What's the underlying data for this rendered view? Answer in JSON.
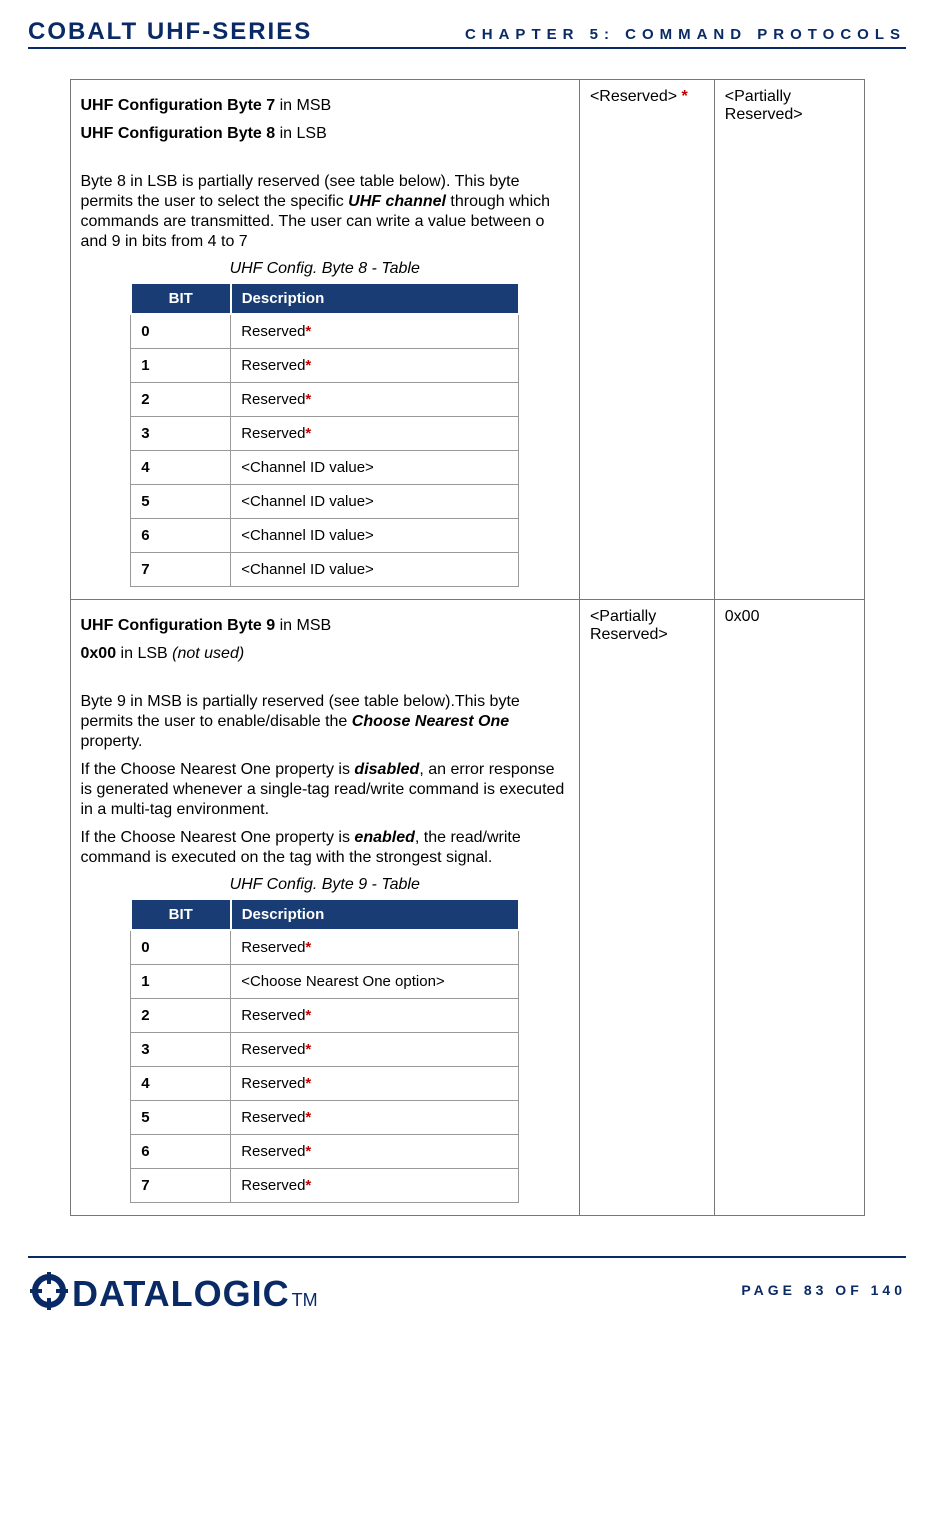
{
  "header": {
    "left": "COBALT UHF-SERIES",
    "right": "CHAPTER 5: COMMAND PROTOCOLS"
  },
  "footer": {
    "logo_text": "DATALOGIC",
    "tm": "TM",
    "page_text": "PAGE 83 OF 140"
  },
  "row1": {
    "line1a": "UHF Configuration Byte 7",
    "line1b": "  in MSB",
    "line2a": "UHF Configuration Byte 8",
    "line2b": " in LSB",
    "para1a": "Byte 8 in LSB is partially reserved (see table below). This byte permits the user to select the specific  ",
    "para1b": "UHF channel",
    "para1c": " through which commands are transmitted. The user can write a value between o and 9 in bits from 4 to 7",
    "caption": "UHF Config. Byte 8 - Table",
    "th_bit": "BIT",
    "th_desc": "Description",
    "bits": [
      {
        "bit": "0",
        "desc": "Reserved",
        "star": "*"
      },
      {
        "bit": "1",
        "desc": "Reserved",
        "star": "*"
      },
      {
        "bit": "2",
        "desc": "Reserved",
        "star": "*"
      },
      {
        "bit": "3",
        "desc": "Reserved",
        "star": "*"
      },
      {
        "bit": "4",
        "desc": "<Channel ID value>",
        "star": ""
      },
      {
        "bit": "5",
        "desc": "<Channel ID value>",
        "star": ""
      },
      {
        "bit": "6",
        "desc": "<Channel ID value>",
        "star": ""
      },
      {
        "bit": "7",
        "desc": "<Channel ID value>",
        "star": ""
      }
    ],
    "mid_a": "<Reserved> ",
    "mid_star": "*",
    "right": "<Partially Reserved>"
  },
  "row2": {
    "line1a": "UHF Configuration Byte 9",
    "line1b": "  in MSB",
    "line2a": "0x00",
    "line2b": " in LSB ",
    "line2c": "(not used)",
    "para1a": "Byte 9 in MSB is partially reserved (see table below).This byte permits the user to enable/disable the ",
    "para1b": "Choose Nearest One",
    "para1c": " property.",
    "para2a": "If the Choose Nearest One property is ",
    "para2b": "disabled",
    "para2c": ", an error response is generated whenever a single-tag read/write command is executed in a multi-tag environment.",
    "para3a": "If the Choose Nearest One property is ",
    "para3b": "enabled",
    "para3c": ", the read/write command is executed on the tag with the strongest signal.",
    "caption": "UHF Config. Byte 9 - Table",
    "th_bit": "BIT",
    "th_desc": "Description",
    "bits": [
      {
        "bit": "0",
        "desc": "Reserved",
        "star": "*"
      },
      {
        "bit": "1",
        "desc": "<Choose Nearest One option>",
        "star": ""
      },
      {
        "bit": "2",
        "desc": "Reserved",
        "star": "*"
      },
      {
        "bit": "3",
        "desc": "Reserved",
        "star": "*"
      },
      {
        "bit": "4",
        "desc": "Reserved",
        "star": "*"
      },
      {
        "bit": "5",
        "desc": "Reserved",
        "star": "*"
      },
      {
        "bit": "6",
        "desc": "Reserved",
        "star": "*"
      },
      {
        "bit": "7",
        "desc": "Reserved",
        "star": "*"
      }
    ],
    "mid": "<Partially Reserved>",
    "right": "0x00"
  }
}
